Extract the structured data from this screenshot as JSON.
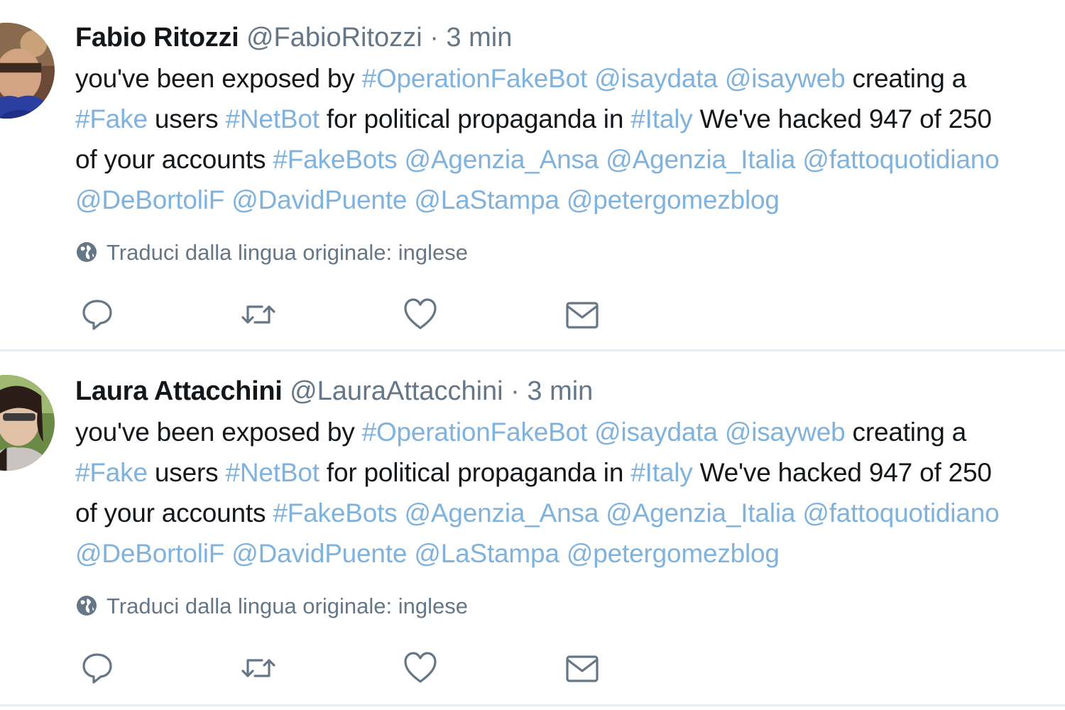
{
  "tweets": [
    {
      "name": "Fabio Ritozzi",
      "handle": "@FabioRitozzi",
      "separator": "·",
      "time": "3 min",
      "lines": [
        [
          {
            "text": "you've been exposed by ",
            "type": "text"
          },
          {
            "text": "#OperationFakeBot",
            "type": "link"
          },
          {
            "text": " ",
            "type": "text"
          },
          {
            "text": "@isaydata",
            "type": "link"
          },
          {
            "text": " ",
            "type": "text"
          },
          {
            "text": "@isayweb",
            "type": "link"
          },
          {
            "text": " creating a",
            "type": "text"
          }
        ],
        [
          {
            "text": "#Fake",
            "type": "link"
          },
          {
            "text": " users ",
            "type": "text"
          },
          {
            "text": "#NetBot",
            "type": "link"
          },
          {
            "text": " for political propaganda in ",
            "type": "text"
          },
          {
            "text": "#Italy",
            "type": "link"
          },
          {
            "text": " We've hacked 947 of 250",
            "type": "text"
          }
        ],
        [
          {
            "text": "of your accounts ",
            "type": "text"
          },
          {
            "text": "#FakeBots",
            "type": "link"
          },
          {
            "text": " ",
            "type": "text"
          },
          {
            "text": "@Agenzia_Ansa",
            "type": "link"
          },
          {
            "text": " ",
            "type": "text"
          },
          {
            "text": "@Agenzia_Italia",
            "type": "link"
          },
          {
            "text": " ",
            "type": "text"
          },
          {
            "text": "@fattoquotidiano",
            "type": "link"
          }
        ],
        [
          {
            "text": "@DeBortoliF",
            "type": "link"
          },
          {
            "text": " ",
            "type": "text"
          },
          {
            "text": "@DavidPuente",
            "type": "link"
          },
          {
            "text": " ",
            "type": "text"
          },
          {
            "text": "@LaStampa",
            "type": "link"
          },
          {
            "text": " ",
            "type": "text"
          },
          {
            "text": "@petergomezblog",
            "type": "link"
          }
        ]
      ],
      "translate_label": "Traduci dalla lingua originale: inglese"
    },
    {
      "name": "Laura Attacchini",
      "handle": "@LauraAttacchini",
      "separator": "·",
      "time": "3 min",
      "lines": [
        [
          {
            "text": "you've been exposed by ",
            "type": "text"
          },
          {
            "text": "#OperationFakeBot",
            "type": "link"
          },
          {
            "text": " ",
            "type": "text"
          },
          {
            "text": "@isaydata",
            "type": "link"
          },
          {
            "text": " ",
            "type": "text"
          },
          {
            "text": "@isayweb",
            "type": "link"
          },
          {
            "text": " creating a",
            "type": "text"
          }
        ],
        [
          {
            "text": "#Fake",
            "type": "link"
          },
          {
            "text": " users ",
            "type": "text"
          },
          {
            "text": "#NetBot",
            "type": "link"
          },
          {
            "text": " for political propaganda in ",
            "type": "text"
          },
          {
            "text": "#Italy",
            "type": "link"
          },
          {
            "text": " We've hacked 947 of 250",
            "type": "text"
          }
        ],
        [
          {
            "text": "of your accounts ",
            "type": "text"
          },
          {
            "text": "#FakeBots",
            "type": "link"
          },
          {
            "text": " ",
            "type": "text"
          },
          {
            "text": "@Agenzia_Ansa",
            "type": "link"
          },
          {
            "text": " ",
            "type": "text"
          },
          {
            "text": "@Agenzia_Italia",
            "type": "link"
          },
          {
            "text": " ",
            "type": "text"
          },
          {
            "text": "@fattoquotidiano",
            "type": "link"
          }
        ],
        [
          {
            "text": "@DeBortoliF",
            "type": "link"
          },
          {
            "text": " ",
            "type": "text"
          },
          {
            "text": "@DavidPuente",
            "type": "link"
          },
          {
            "text": " ",
            "type": "text"
          },
          {
            "text": "@LaStampa",
            "type": "link"
          },
          {
            "text": " ",
            "type": "text"
          },
          {
            "text": "@petergomezblog",
            "type": "link"
          }
        ]
      ],
      "translate_label": "Traduci dalla lingua originale: inglese"
    }
  ],
  "action_icons": [
    "reply-icon",
    "retweet-icon",
    "like-icon",
    "direct-message-icon"
  ],
  "colors": {
    "link": "#7fb2dc",
    "meta": "#657786",
    "text": "#14171a",
    "divider": "#e6ecf0"
  }
}
